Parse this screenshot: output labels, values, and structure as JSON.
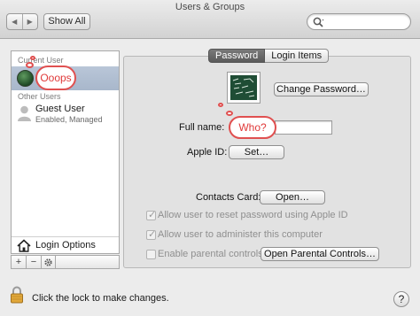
{
  "window": {
    "title": "Users & Groups"
  },
  "toolbar": {
    "back_glyph": "◀",
    "forward_glyph": "▶",
    "show_all_label": "Show All",
    "search_placeholder": ""
  },
  "sidebar": {
    "current_user_header": "Current User",
    "other_users_header": "Other Users",
    "guest": {
      "name": "Guest User",
      "status": "Enabled, Managed"
    },
    "login_options_label": "Login Options",
    "add_glyph": "+",
    "remove_glyph": "−"
  },
  "tabs": [
    {
      "label": "Password",
      "active": true
    },
    {
      "label": "Login Items",
      "active": false
    }
  ],
  "form": {
    "change_password_label": "Change Password…",
    "full_name_label": "Full name:",
    "full_name_value": "",
    "apple_id_label": "Apple ID:",
    "set_label": "Set…",
    "contacts_card_label": "Contacts Card:",
    "open_label": "Open…",
    "check_reset": "Allow user to reset password using Apple ID",
    "check_admin": "Allow user to administer this computer",
    "check_parental": "Enable parental controls",
    "open_parental_label": "Open Parental Controls…"
  },
  "annotations": {
    "bubble1": "Ooops",
    "bubble2": "Who?"
  },
  "footer": {
    "lock_text": "Click the lock to make changes.",
    "help_glyph": "?"
  },
  "colors": {
    "accent_selection": "#b2c0d4",
    "annotation_red": "#e05050"
  },
  "icons": [
    "search-icon",
    "gear-icon",
    "house-icon",
    "lock-icon",
    "user-silhouette-icon"
  ]
}
